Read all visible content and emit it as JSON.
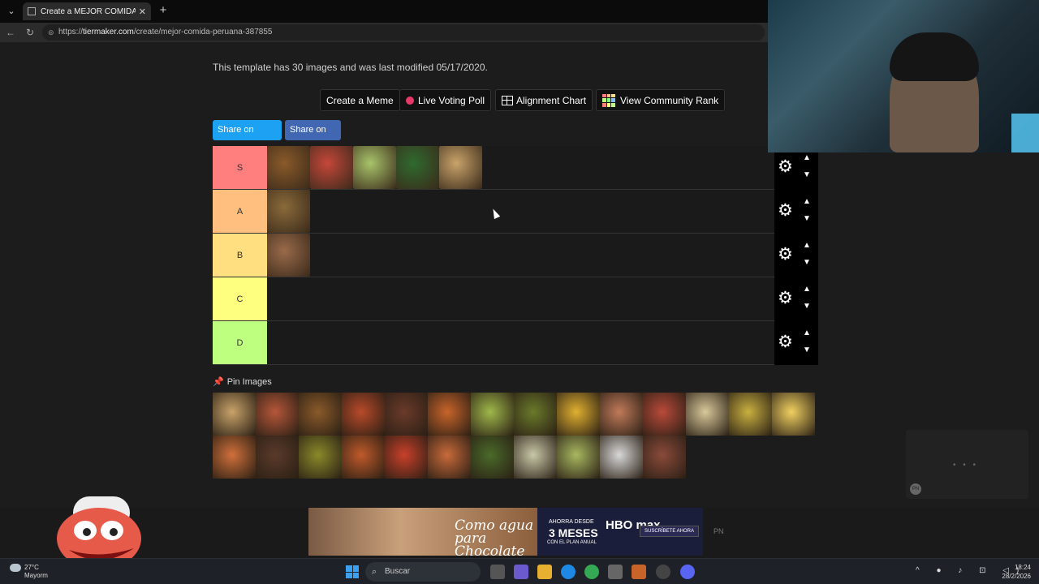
{
  "browser": {
    "menu_icon": "chevron-down-icon",
    "tab_title": "Create a MEJOR COMIDA PERUANA",
    "tab_close": "✕",
    "new_tab": "+",
    "url_host": "tiermaker.com",
    "url_prefix": "https://",
    "url_path": "/create/mejor-comida-peruana-387855"
  },
  "page": {
    "info": "This template has 30 images and was last modified 05/17/2020.",
    "toolbar": {
      "meme": "Create a Meme",
      "poll": "Live Voting Poll",
      "alignment": "Alignment Chart",
      "community": "View Community Rank"
    },
    "share": {
      "twitter": "Share on Twitter",
      "fb": "Share on FB"
    },
    "tiers": [
      {
        "label": "S",
        "color": "#ff7f7f",
        "images": [
          "#8a5a2a",
          "#c4473a",
          "#a8c46a",
          "#2f6a2f",
          "#c9a36a"
        ]
      },
      {
        "label": "A",
        "color": "#ffbf7f",
        "images": [
          "#8a6a3a"
        ]
      },
      {
        "label": "B",
        "color": "#ffdf7f",
        "images": [
          "#9a6a4a"
        ]
      },
      {
        "label": "C",
        "color": "#ffff7f",
        "images": []
      },
      {
        "label": "D",
        "color": "#bfff7f",
        "images": []
      }
    ],
    "pin_label": "Pin Images",
    "pool_images": [
      "#c9a36a",
      "#b5573a",
      "#8a5a2a",
      "#b84a2a",
      "#6a3a2a",
      "#c8642a",
      "#9fb84a",
      "#6a7a2a",
      "#e0b030",
      "#c07a5a",
      "#b84a3a",
      "#d8c89a",
      "#c8b040",
      "#f0d060",
      "#d0703a",
      "#5a3a2a",
      "#8a8a2a",
      "#c05a2a",
      "#c8402a",
      "#c86a3a",
      "#4a6a2a",
      "#c8c8a8",
      "#a8b860",
      "#d8d8d8",
      "#8a4a3a"
    ],
    "side_box_dots": "• • •",
    "side_box_badge": "PN"
  },
  "ad": {
    "left_text": "Como agua para Chocolate",
    "l1": "AHORRA DESDE",
    "l2": "3 MESES",
    "l3": "CON EL PLAN ANUAL",
    "brand": "HBO max",
    "cta": "SUSCRÍBETE AHORA",
    "pn": "PN"
  },
  "taskbar": {
    "temp": "27°C",
    "weather_desc": "Mayorm",
    "search": "Buscar",
    "time": "18:24",
    "date": "28/2/2026"
  },
  "colors": {
    "accent_live": "#e8386a",
    "twitter": "#1da1f2",
    "fb": "#4267b2"
  }
}
